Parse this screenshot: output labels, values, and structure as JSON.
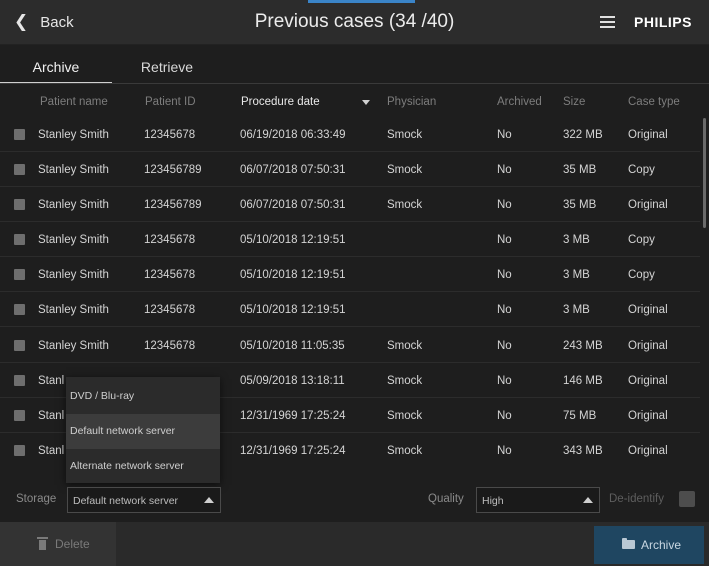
{
  "header": {
    "back_label": "Back",
    "back_icon": "chevron-left-icon",
    "title": "Previous cases (34 /40)",
    "menu_icon": "hamburger-menu-icon",
    "brand": "PHILIPS"
  },
  "tabs": [
    {
      "label": "Archive",
      "active": true
    },
    {
      "label": "Retrieve",
      "active": false
    }
  ],
  "table": {
    "columns": [
      "Patient name",
      "Patient ID",
      "Procedure date",
      "Physician",
      "Archived",
      "Size",
      "Case type"
    ],
    "sorted_column": "Procedure date",
    "rows": [
      {
        "name": "Stanley Smith",
        "id": "12345678",
        "date": "06/19/2018 06:33:49",
        "physician": "Smock",
        "archived": "No",
        "size": "322 MB",
        "type": "Original"
      },
      {
        "name": "Stanley Smith",
        "id": "123456789",
        "date": "06/07/2018 07:50:31",
        "physician": "Smock",
        "archived": "No",
        "size": "35 MB",
        "type": "Copy"
      },
      {
        "name": "Stanley Smith",
        "id": "123456789",
        "date": "06/07/2018 07:50:31",
        "physician": "Smock",
        "archived": "No",
        "size": "35 MB",
        "type": "Original"
      },
      {
        "name": "Stanley Smith",
        "id": "12345678",
        "date": "05/10/2018 12:19:51",
        "physician": "",
        "archived": "No",
        "size": "3 MB",
        "type": "Copy"
      },
      {
        "name": "Stanley Smith",
        "id": "12345678",
        "date": "05/10/2018 12:19:51",
        "physician": "",
        "archived": "No",
        "size": "3 MB",
        "type": "Copy"
      },
      {
        "name": "Stanley Smith",
        "id": "12345678",
        "date": "05/10/2018 12:19:51",
        "physician": "",
        "archived": "No",
        "size": "3 MB",
        "type": "Original"
      },
      {
        "name": "Stanley Smith",
        "id": "12345678",
        "date": "05/10/2018 11:05:35",
        "physician": "Smock",
        "archived": "No",
        "size": "243 MB",
        "type": "Original"
      },
      {
        "name": "Stanl",
        "id": "",
        "date": "05/09/2018 13:18:11",
        "physician": "Smock",
        "archived": "No",
        "size": "146 MB",
        "type": "Original"
      },
      {
        "name": "Stanl",
        "id": "",
        "date": "12/31/1969 17:25:24",
        "physician": "Smock",
        "archived": "No",
        "size": "75 MB",
        "type": "Original"
      },
      {
        "name": "Stanl",
        "id": "",
        "date": "12/31/1969 17:25:24",
        "physician": "Smock",
        "archived": "No",
        "size": "343 MB",
        "type": "Original"
      }
    ]
  },
  "storage": {
    "label": "Storage",
    "selected": "Default network server",
    "options": [
      "DVD / Blu-ray",
      "Default network server",
      "Alternate network server"
    ]
  },
  "quality": {
    "label": "Quality",
    "selected": "High"
  },
  "deidentify": {
    "label": "De-identify",
    "checked": false
  },
  "footer": {
    "delete_label": "Delete",
    "delete_icon": "trash-icon",
    "archive_label": "Archive",
    "archive_icon": "folder-icon"
  }
}
